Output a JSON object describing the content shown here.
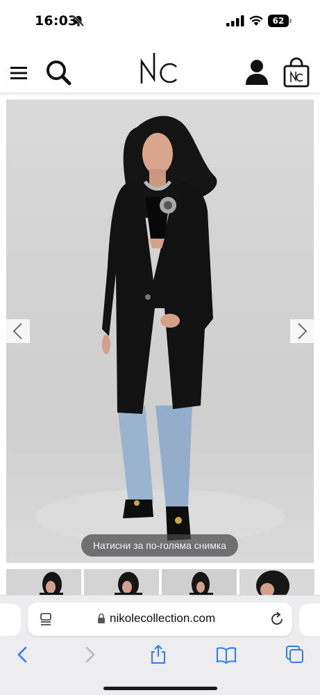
{
  "status_bar": {
    "time": "16:03",
    "battery": "62",
    "icons": [
      "bell-slash-icon",
      "cellular-signal-icon",
      "wifi-icon",
      "battery-icon"
    ]
  },
  "header": {
    "logo_text": "NC",
    "icons": [
      "menu-icon",
      "search-icon",
      "user-icon",
      "shopping-bag-icon"
    ]
  },
  "product": {
    "image_subject": "model-in-black-coat",
    "enlarge_hint": "Натисни за по-голяма снимка",
    "thumbnails_count": 4
  },
  "browser": {
    "url": "nikolecollection.com",
    "toolbar": [
      "back-icon",
      "forward-icon",
      "share-icon",
      "bookmarks-icon",
      "tabs-icon"
    ]
  },
  "colors": {
    "accent": "#2f7bf5",
    "disabled": "#b8b8bd",
    "coat": "#121212",
    "jeans": "#9ab3cf"
  }
}
